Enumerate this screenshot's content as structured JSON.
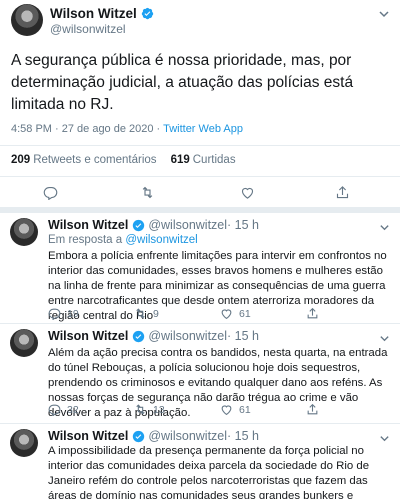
{
  "main_tweet": {
    "author_name": "Wilson Witzel",
    "author_handle": "@wilsonwitzel",
    "text": "A segurança pública é nossa prioridade, mas, por determinação judicial, a atuação das polícias está limitada no RJ.",
    "timestamp": "4:58 PM · 27 de ago de 2020 · ",
    "source_app": "Twitter Web App",
    "retweets_count": "209",
    "retweets_label": "Retweets e comentários",
    "likes_count": "619",
    "likes_label": "Curtidas"
  },
  "replies": [
    {
      "author_name": "Wilson Witzel",
      "author_handle": "@wilsonwitzel",
      "time": " · 15 h",
      "in_reply_prefix": "Em resposta a ",
      "in_reply_handle": "@wilsonwitzel",
      "text": "Embora a polícia enfrente limitações para intervir em confrontos no interior das comunidades, esses bravos homens e mulheres estão na linha de frente para minimizar as consequências de uma guerra entre narcotraficantes que desde ontem aterroriza moradores da região central do Rio",
      "reply_count": "19",
      "retweet_count": "9",
      "like_count": "61"
    },
    {
      "author_name": "Wilson Witzel",
      "author_handle": "@wilsonwitzel",
      "time": " · 15 h",
      "text": "Além da ação precisa contra os bandidos, nesta quarta, na entrada do túnel Rebouças, a polícia solucionou hoje dois sequestros, prendendo os criminosos e evitando qualquer dano aos reféns. As nossas forças de segurança não darão trégua ao crime e vão devolver a paz à população.",
      "reply_count": "32",
      "retweet_count": "13",
      "like_count": "61"
    },
    {
      "author_name": "Wilson Witzel",
      "author_handle": "@wilsonwitzel",
      "time": " · 15 h",
      "text": "A impossibilidade da presença permanente da força policial no interior das comunidades deixa parcela da sociedade do Rio de Janeiro refém do controle pelos narcoterroristas que fazem das áreas de domínio nas comunidades seus grandes bunkers e expandem livremente sua atuação."
    }
  ],
  "colors": {
    "accent": "#1da1f2",
    "link": "#1b95e0",
    "muted": "#657786",
    "text": "#14171a",
    "divider": "#e6ecf0"
  },
  "icons": [
    "verified-badge-icon",
    "chevron-down-icon",
    "reply-icon",
    "retweet-icon",
    "like-icon",
    "share-icon"
  ]
}
